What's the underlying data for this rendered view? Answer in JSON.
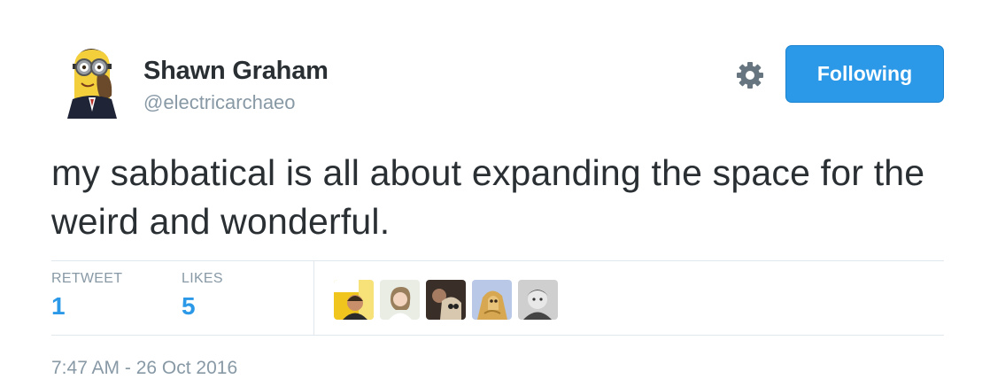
{
  "user": {
    "name": "Shawn Graham",
    "handle": "@electricarchaeo",
    "avatar_icon": "minion-avatar"
  },
  "actions": {
    "settings_icon": "gear-icon",
    "follow_label": "Following"
  },
  "tweet": {
    "text": "my sabbatical is all about expanding the space for the weird and wonderful."
  },
  "stats": {
    "retweet_label": "RETWEET",
    "retweet_count": "1",
    "likes_label": "LIKES",
    "likes_count": "5"
  },
  "likers": [
    "liker-avatar-1",
    "liker-avatar-2",
    "liker-avatar-3",
    "liker-avatar-4",
    "liker-avatar-5"
  ],
  "timestamp": "7:47 AM - 26 Oct 2016",
  "colors": {
    "accent": "#2b99e7",
    "muted": "#8899a6",
    "text": "#292f33",
    "divider": "#e1e8ed"
  }
}
